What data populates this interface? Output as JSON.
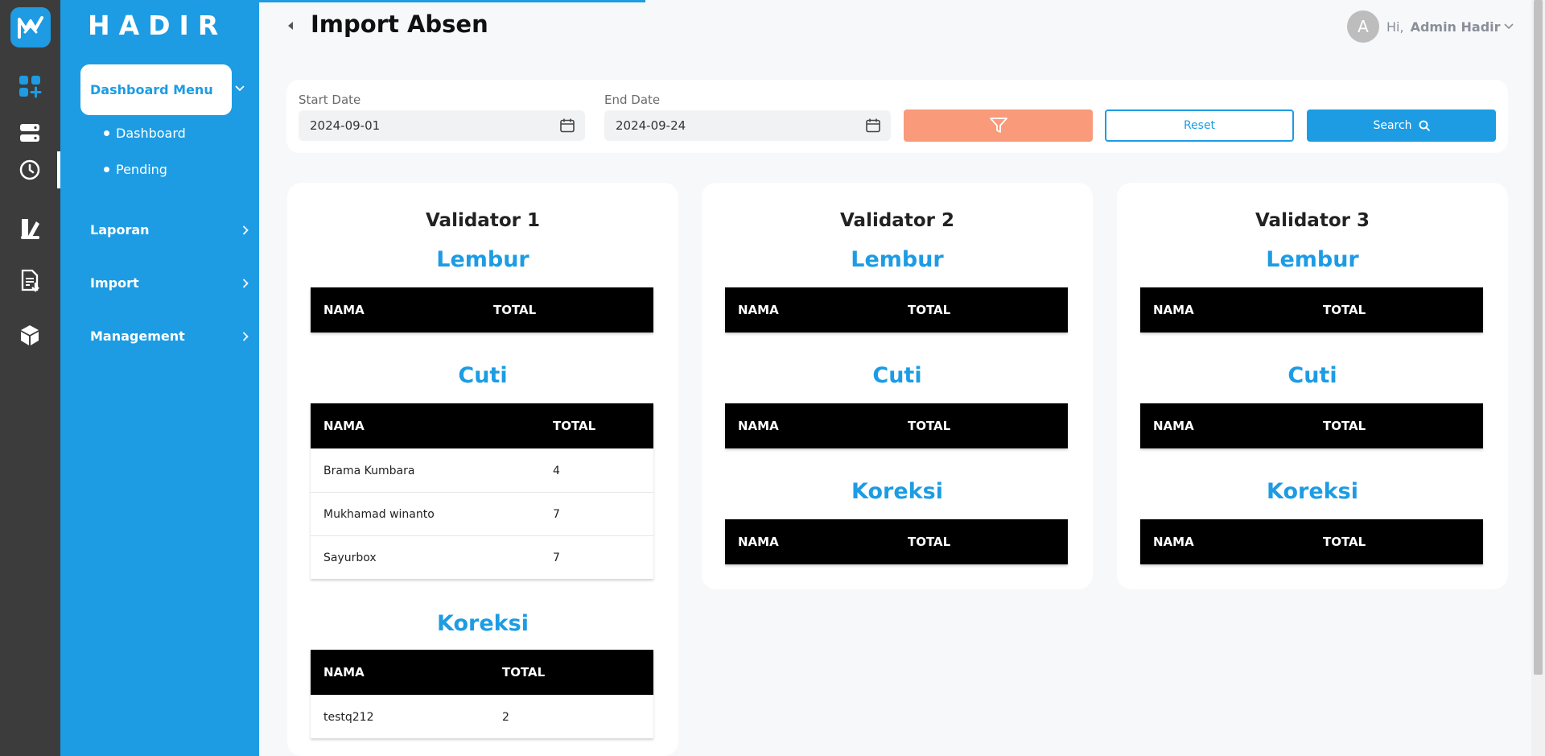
{
  "app": {
    "brand": "HADIR",
    "page_title": "Import Absen"
  },
  "colors": {
    "primary": "#1d9ce4",
    "rail": "#3c3c3c",
    "filter_button": "#f99a7a",
    "table_header": "#000000"
  },
  "rail_icons": [
    "dashboard-add-icon",
    "server-icon",
    "clock-icon",
    "report-icon",
    "document-import-icon",
    "box-icon"
  ],
  "sidebar": {
    "menu_head": "Dashboard Menu",
    "sub_items": [
      "Dashboard",
      "Pending"
    ],
    "nav": [
      "Laporan",
      "Import",
      "Management"
    ]
  },
  "user": {
    "avatar_initial": "A",
    "greeting": "Hi,",
    "name": "Admin Hadir"
  },
  "filter": {
    "start_label": "Start Date",
    "start_value": "2024-09-01",
    "end_label": "End Date",
    "end_value": "2024-09-24",
    "reset_label": "Reset",
    "search_label": "Search"
  },
  "table_headers": {
    "name": "NAMA",
    "total": "TOTAL"
  },
  "validators": [
    {
      "title": "Validator 1",
      "sections": [
        {
          "title": "Lembur",
          "rows": []
        },
        {
          "title": "Cuti",
          "rows": [
            {
              "nama": "Brama Kumbara",
              "total": "4"
            },
            {
              "nama": "Mukhamad winanto",
              "total": "7"
            },
            {
              "nama": "Sayurbox",
              "total": "7"
            }
          ]
        },
        {
          "title": "Koreksi",
          "rows": [
            {
              "nama": "testq212",
              "total": "2"
            }
          ]
        }
      ]
    },
    {
      "title": "Validator 2",
      "sections": [
        {
          "title": "Lembur",
          "rows": []
        },
        {
          "title": "Cuti",
          "rows": []
        },
        {
          "title": "Koreksi",
          "rows": []
        }
      ]
    },
    {
      "title": "Validator 3",
      "sections": [
        {
          "title": "Lembur",
          "rows": []
        },
        {
          "title": "Cuti",
          "rows": []
        },
        {
          "title": "Koreksi",
          "rows": []
        }
      ]
    }
  ]
}
